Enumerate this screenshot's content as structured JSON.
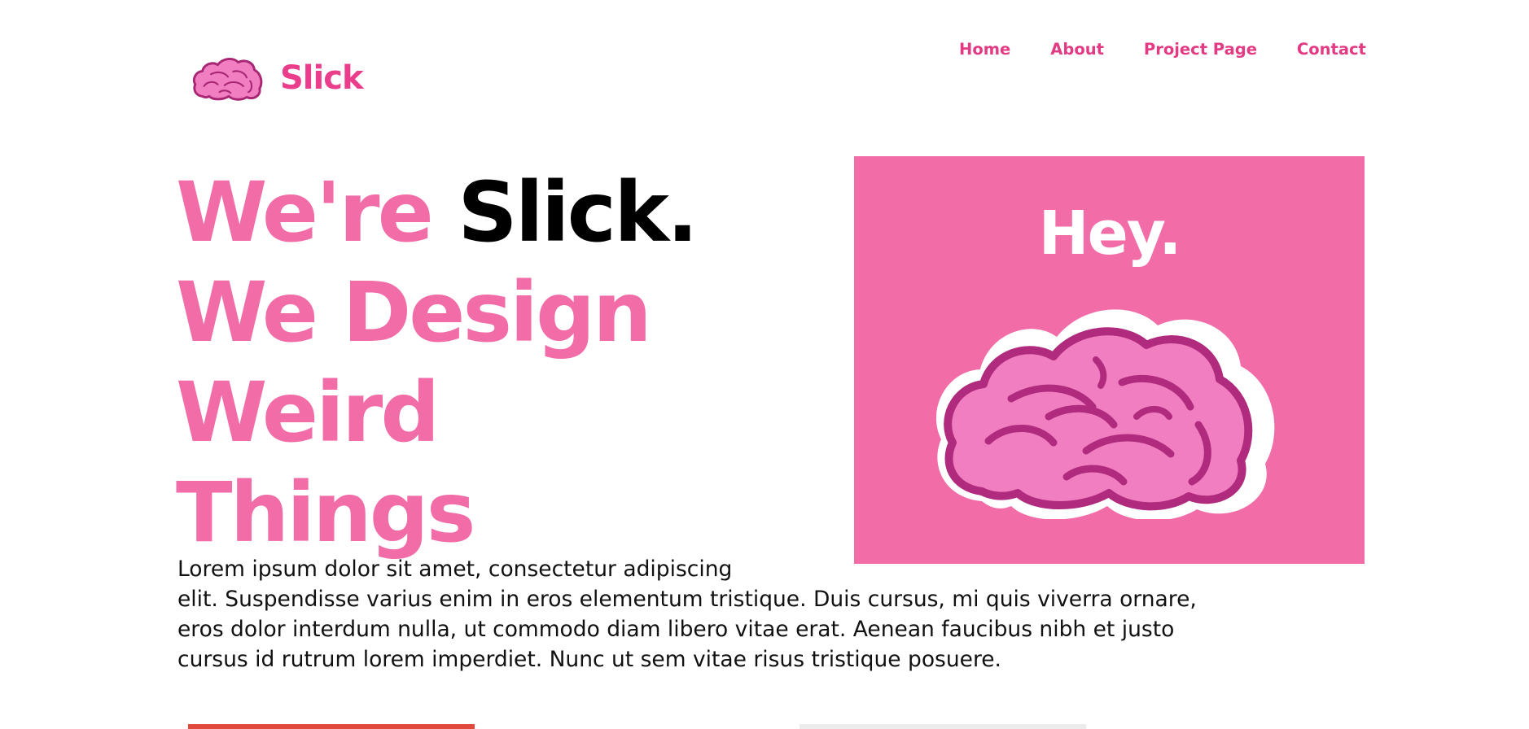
{
  "header": {
    "logo_text": "Slick",
    "logo_icon": "brain-icon",
    "nav": [
      "Home",
      "About",
      "Project Page",
      "Contact"
    ]
  },
  "hero": {
    "title_line1_pink": "We're ",
    "title_line1_dark": "Slick.",
    "title_line2": "We Design",
    "title_line3": "Weird",
    "title_line4": "Things",
    "card_text": "Hey.",
    "card_icon": "brain-icon",
    "paragraph_lines": [
      "Lorem ipsum dolor sit amet, consectetur adipiscing",
      "elit. Suspendisse varius enim in eros elementum tristique. Duis cursus, mi quis viverra ornare,",
      "eros dolor interdum nulla, ut commodo diam libero vitae erat. Aenean faucibus nibh et justo",
      "cursus id rutrum lorem imperdiet. Nunc ut sem vitae risus tristique posuere."
    ]
  },
  "colors": {
    "brand_pink": "#ea3d8c",
    "title_pink": "#f26ca8",
    "card_background": "#f26ca8",
    "brain_dark": "#b02a7d",
    "brain_light": "#f07ec0",
    "bottom_button_left": "#e0483b"
  }
}
